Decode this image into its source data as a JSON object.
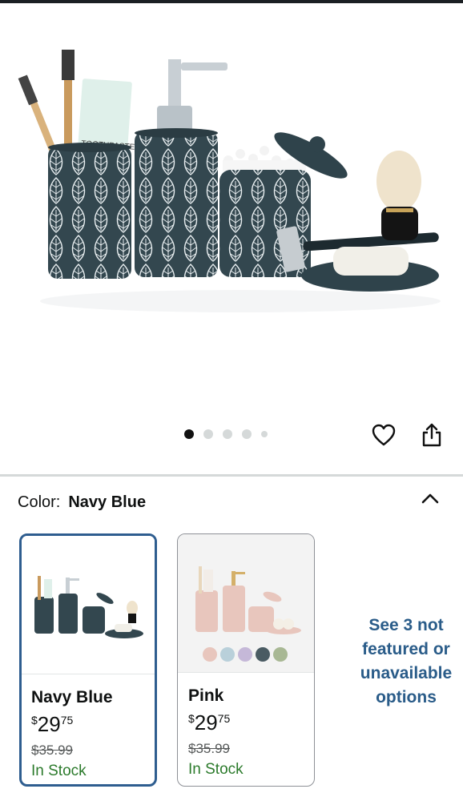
{
  "image_carousel": {
    "dots": [
      true,
      false,
      false,
      false,
      false
    ],
    "hero_alt": "Navy blue bathroom accessories set"
  },
  "product_image_text": {
    "tube_label": "TOOTHPASTE"
  },
  "actions": {
    "wishlist_icon": "heart-icon",
    "share_icon": "share-icon"
  },
  "color_selector": {
    "label": "Color:",
    "selected": "Navy Blue",
    "collapse_icon": "chevron-up-icon"
  },
  "swatches": [
    {
      "name": "Navy Blue",
      "currency": "$",
      "dollars": "29",
      "cents": "75",
      "list_price": "$35.99",
      "stock": "In Stock",
      "selected": true,
      "color": "#33474f"
    },
    {
      "name": "Pink",
      "currency": "$",
      "dollars": "29",
      "cents": "75",
      "list_price": "$35.99",
      "stock": "In Stock",
      "selected": false,
      "color": "#e8c6bd"
    }
  ],
  "see_more": {
    "line1": "See 3 not",
    "line2": "featured or",
    "line3": "unavailable",
    "line4": "options"
  },
  "colors": {
    "link": "#2a5c89",
    "in_stock": "#2b7a2b",
    "selected_border": "#2e5d8f",
    "navy": "#33474f",
    "pink": "#e8c6bd"
  }
}
